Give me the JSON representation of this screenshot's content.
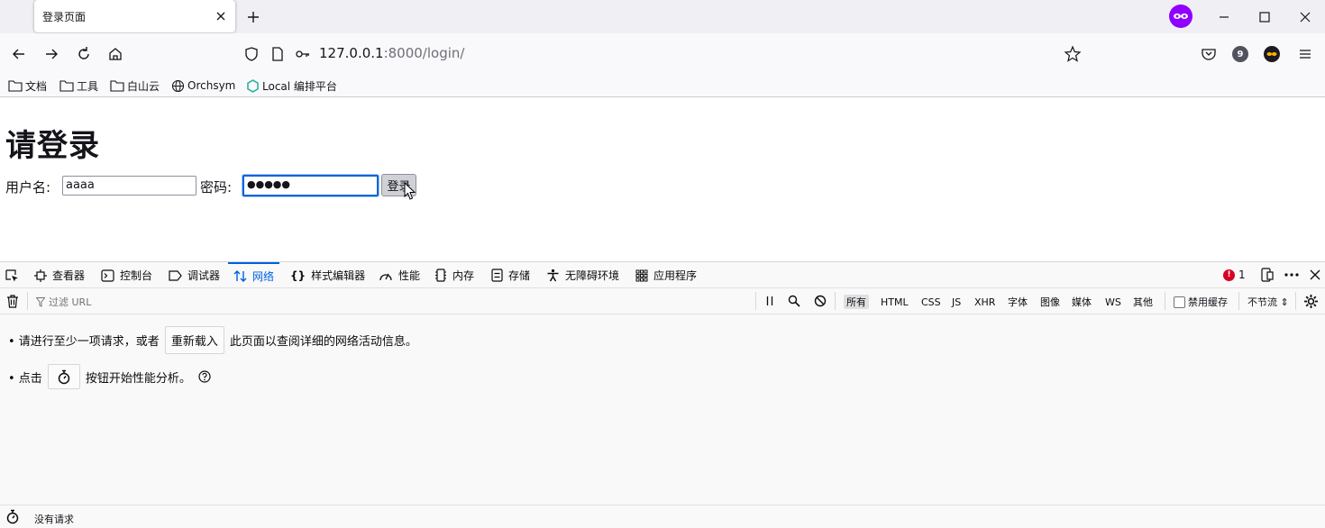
{
  "browser": {
    "tab_title": "登录页面",
    "url_host": "127.0.0.1",
    "url_rest": ":8000/login/",
    "extension_badge": "9",
    "bookmarks": [
      {
        "label": "文档",
        "icon": "folder-icon"
      },
      {
        "label": "工具",
        "icon": "folder-icon"
      },
      {
        "label": "白山云",
        "icon": "folder-icon"
      },
      {
        "label": "Orchsym",
        "icon": "globe-icon"
      },
      {
        "label": "Local 编排平台",
        "icon": "hexagon-icon"
      }
    ]
  },
  "page": {
    "heading": "请登录",
    "username_label": "用户名:",
    "username_value": "aaaa",
    "password_label": "密码:",
    "password_value": "●●●●●",
    "submit_label": "登录"
  },
  "devtools": {
    "tabs": [
      {
        "label": "查看器",
        "icon": "inspector-icon"
      },
      {
        "label": "控制台",
        "icon": "console-icon"
      },
      {
        "label": "调试器",
        "icon": "debugger-icon"
      },
      {
        "label": "网络",
        "icon": "network-icon"
      },
      {
        "label": "样式编辑器",
        "icon": "style-editor-icon"
      },
      {
        "label": "性能",
        "icon": "performance-icon"
      },
      {
        "label": "内存",
        "icon": "memory-icon"
      },
      {
        "label": "存储",
        "icon": "storage-icon"
      },
      {
        "label": "无障碍环境",
        "icon": "accessibility-icon"
      },
      {
        "label": "应用程序",
        "icon": "application-icon"
      }
    ],
    "active_tab": "网络",
    "error_count": "1",
    "filter_placeholder": "过滤 URL",
    "type_filters": [
      "所有",
      "HTML",
      "CSS",
      "JS",
      "XHR",
      "字体",
      "图像",
      "媒体",
      "WS",
      "其他"
    ],
    "selected_filter": "所有",
    "disable_cache_label": "禁用缓存",
    "throttle_label": "不节流 ⇕",
    "message1_prefix": "• 请进行至少一项请求，或者",
    "reload_button": "重新载入",
    "message1_suffix": "此页面以查阅详细的网络活动信息。",
    "message2_prefix": "• 点击",
    "message2_suffix": "按钮开始性能分析。",
    "status_text": "没有请求"
  },
  "colors": {
    "accent": "#0060df",
    "focus": "#0a64d8",
    "error": "#d70022",
    "extension": "#8f00ff"
  }
}
